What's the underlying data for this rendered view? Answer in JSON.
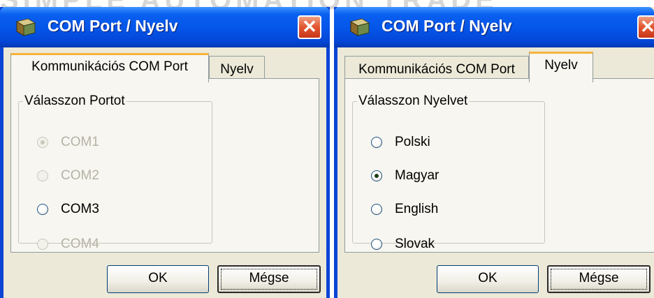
{
  "background": {
    "watermark": "SIMPLE AUTOMATION TRADE"
  },
  "colors": {
    "title_blue": "#0455e8",
    "close_red": "#e2552f",
    "tab_highlight": "#f6b33b",
    "face": "#ece9d8"
  },
  "window1": {
    "title": "COM Port / Nyelv",
    "icon": "app-icon",
    "close_icon": "close-icon",
    "tabs": [
      {
        "label": "Kommunikációs COM Port",
        "active": true
      },
      {
        "label": "Nyelv",
        "active": false
      }
    ],
    "group": {
      "legend": "Válasszon Portot",
      "options": [
        {
          "label": "COM1",
          "checked": true,
          "enabled": false
        },
        {
          "label": "COM2",
          "checked": false,
          "enabled": false
        },
        {
          "label": "COM3",
          "checked": false,
          "enabled": true
        },
        {
          "label": "COM4",
          "checked": false,
          "enabled": false
        }
      ]
    },
    "ok_label": "OK",
    "cancel_label": "Mégse"
  },
  "window2": {
    "title": "COM Port / Nyelv",
    "icon": "app-icon",
    "close_icon": "close-icon",
    "tabs": [
      {
        "label": "Kommunikációs COM Port",
        "active": false
      },
      {
        "label": "Nyelv",
        "active": true
      }
    ],
    "group": {
      "legend": "Válasszon Nyelvet",
      "options": [
        {
          "label": "Polski",
          "checked": false,
          "enabled": true
        },
        {
          "label": "Magyar",
          "checked": true,
          "enabled": true
        },
        {
          "label": "English",
          "checked": false,
          "enabled": true
        },
        {
          "label": "Slovak",
          "checked": false,
          "enabled": true
        }
      ]
    },
    "ok_label": "OK",
    "cancel_label": "Mégse"
  }
}
